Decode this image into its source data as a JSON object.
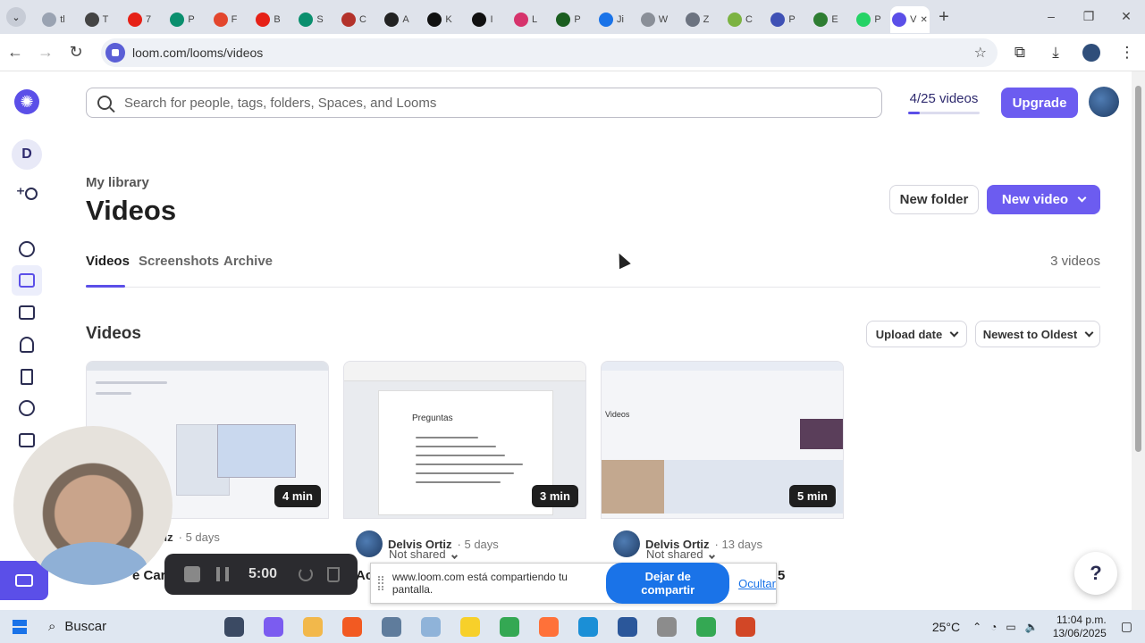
{
  "browser": {
    "tabs": [
      {
        "icon": "circle-icon",
        "color": "#9aa3b2",
        "label": "tl"
      },
      {
        "icon": "github-icon",
        "color": "#444444",
        "label": "T"
      },
      {
        "icon": "youtube-icon",
        "color": "#e62117",
        "label": "7"
      },
      {
        "icon": "page-icon",
        "color": "#0a8f6e",
        "label": "P"
      },
      {
        "icon": "hf-icon",
        "color": "#e3462d",
        "label": "F"
      },
      {
        "icon": "youtube-icon",
        "color": "#e62117",
        "label": "B"
      },
      {
        "icon": "page-icon",
        "color": "#0a8f6e",
        "label": "S"
      },
      {
        "icon": "image-icon",
        "color": "#b3322b",
        "label": "C"
      },
      {
        "icon": "pause-icon",
        "color": "#222222",
        "label": "A"
      },
      {
        "icon": "x-icon",
        "color": "#111111",
        "label": "K"
      },
      {
        "icon": "x-icon",
        "color": "#111111",
        "label": "I"
      },
      {
        "icon": "record-icon",
        "color": "#d6336c",
        "label": "L"
      },
      {
        "icon": "uec-icon",
        "color": "#1b5e20",
        "label": "P"
      },
      {
        "icon": "circle-icon",
        "color": "#1a73e8",
        "label": "Ji"
      },
      {
        "icon": "play-icon",
        "color": "#8a8f98",
        "label": "W"
      },
      {
        "icon": "circle-icon",
        "color": "#6c7380",
        "label": "Z"
      },
      {
        "icon": "circle-icon",
        "color": "#7cb342",
        "label": "C"
      },
      {
        "icon": "p-icon",
        "color": "#3f51b5",
        "label": "P"
      },
      {
        "icon": "globe-icon",
        "color": "#2e7d32",
        "label": "E"
      },
      {
        "icon": "whatsapp-icon",
        "color": "#25d366",
        "label": "P"
      },
      {
        "icon": "loom-icon",
        "color": "#5b4fe8",
        "label": "V"
      }
    ],
    "url": "loom.com/looms/videos"
  },
  "header": {
    "search_placeholder": "Search for people, tags, folders, Spaces, and Looms",
    "quota_label": "4/25 videos",
    "quota_used": 4,
    "quota_total": 25,
    "upgrade_label": "Upgrade"
  },
  "sidebar": {
    "workspace_initial": "D"
  },
  "library": {
    "breadcrumb": "My library",
    "title": "Videos",
    "new_folder_label": "New folder",
    "new_video_label": "New video",
    "tabs": [
      "Videos",
      "Screenshots",
      "Archive"
    ],
    "count_label": "3 videos",
    "section_title": "Videos",
    "sort_field": "Upload date",
    "sort_order": "Newest to Oldest"
  },
  "videos": [
    {
      "duration": "4 min",
      "author": "Ortiz",
      "age": "5 days",
      "title": "e Care"
    },
    {
      "duration": "3 min",
      "author": "Delvis Ortiz",
      "age": "5 days",
      "shared": "Not shared",
      "title": "Ac"
    },
    {
      "duration": "5 min",
      "author": "Delvis Ortiz",
      "age": "13 days",
      "shared": "Not shared",
      "title": "5"
    }
  ],
  "thumb2": {
    "heading": "Preguntas"
  },
  "thumb3": {
    "heading": "Videos"
  },
  "recorder": {
    "time": "5:00"
  },
  "share_banner": {
    "message": "www.loom.com está compartiendo tu pantalla.",
    "stop_label": "Dejar de compartir",
    "hide_label": "Ocultar"
  },
  "help_label": "?",
  "taskbar": {
    "search_label": "Buscar",
    "apps": [
      {
        "name": "task-view",
        "color": "#3b4a63"
      },
      {
        "name": "copilot",
        "color": "#7b5cf0"
      },
      {
        "name": "file-explorer",
        "color": "#f2b84b"
      },
      {
        "name": "brave",
        "color": "#f25a22"
      },
      {
        "name": "app-blue",
        "color": "#5f7c9c"
      },
      {
        "name": "notepad",
        "color": "#8fb3d9"
      },
      {
        "name": "sticky-notes",
        "color": "#f7d02a"
      },
      {
        "name": "chrome",
        "color": "#34a853"
      },
      {
        "name": "firefox",
        "color": "#ff7139"
      },
      {
        "name": "edge",
        "color": "#1b8fd6"
      },
      {
        "name": "word",
        "color": "#2b579a"
      },
      {
        "name": "paint",
        "color": "#8c8c8c"
      },
      {
        "name": "chrome-active",
        "color": "#34a853"
      },
      {
        "name": "powerpoint",
        "color": "#d24726"
      }
    ],
    "temperature": "25°C",
    "time": "11:04 p.m.",
    "date": "13/06/2025"
  }
}
